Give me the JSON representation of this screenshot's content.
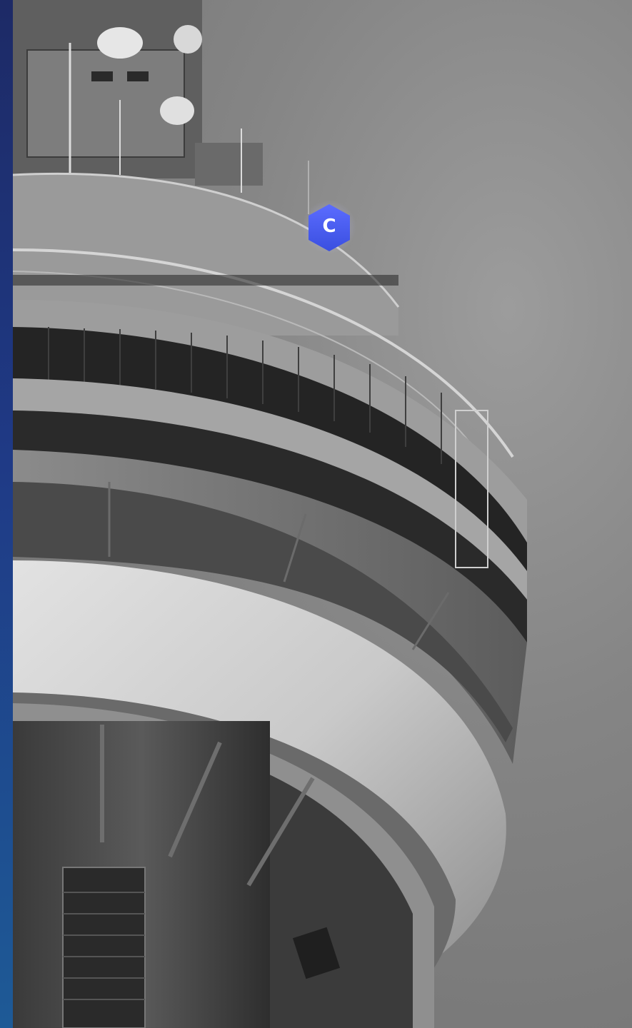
{
  "logo": {
    "letter": "C",
    "icon": "hexagon-c-logo-icon",
    "color_top": "#5b6cff",
    "color_bottom": "#3a4fe0"
  },
  "background": {
    "photo_subject": "tower-observation-deck-photo",
    "accent_stripe_top": "#1d2a66",
    "accent_stripe_bottom": "#1e5a96"
  }
}
